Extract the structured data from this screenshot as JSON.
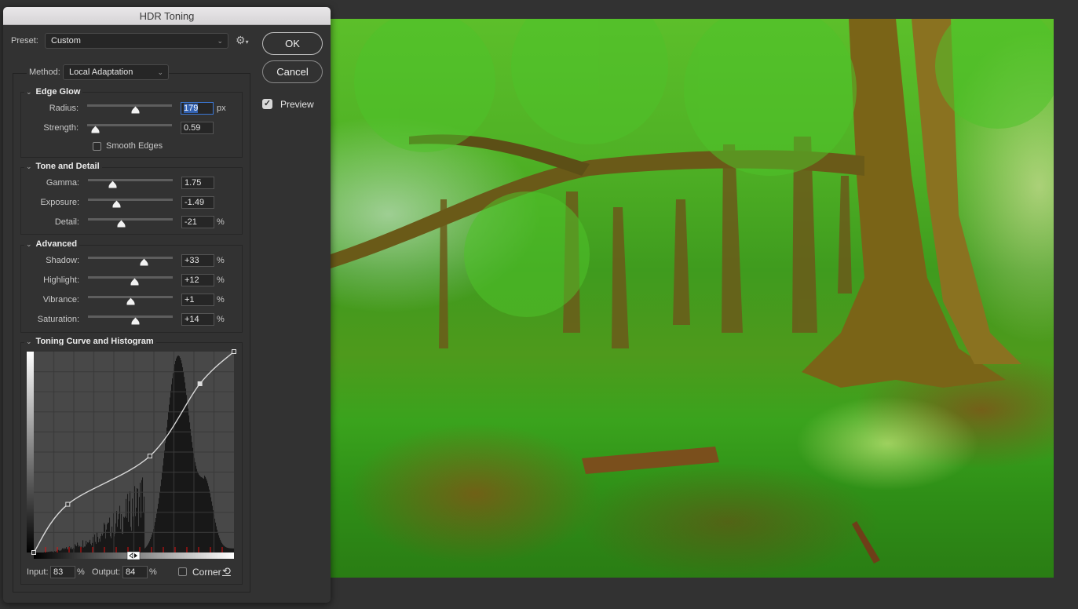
{
  "dialog": {
    "title": "HDR Toning",
    "preset": {
      "label": "Preset:",
      "value": "Custom",
      "gear_icon": "gear-icon"
    },
    "buttons": {
      "ok": "OK",
      "cancel": "Cancel"
    },
    "preview": {
      "label": "Preview",
      "checked": true
    },
    "method": {
      "label": "Method:",
      "value": "Local Adaptation"
    },
    "sections": {
      "edge_glow": {
        "title": "Edge Glow",
        "radius": {
          "label": "Radius:",
          "value": "179",
          "unit": "px",
          "slider_fraction": 0.57
        },
        "strength": {
          "label": "Strength:",
          "value": "0.59",
          "slider_fraction": 0.1
        },
        "smooth_edges": {
          "label": "Smooth Edges",
          "checked": false
        }
      },
      "tone_detail": {
        "title": "Tone and Detail",
        "gamma": {
          "label": "Gamma:",
          "value": "1.75",
          "slider_fraction": 0.29
        },
        "exposure": {
          "label": "Exposure:",
          "value": "-1.49",
          "slider_fraction": 0.34
        },
        "detail": {
          "label": "Detail:",
          "value": "-21",
          "unit": "%",
          "slider_fraction": 0.39
        }
      },
      "advanced": {
        "title": "Advanced",
        "shadow": {
          "label": "Shadow:",
          "value": "+33",
          "unit": "%",
          "slider_fraction": 0.66
        },
        "highlight": {
          "label": "Highlight:",
          "value": "+12",
          "unit": "%",
          "slider_fraction": 0.55
        },
        "vibrance": {
          "label": "Vibrance:",
          "value": "+1",
          "unit": "%",
          "slider_fraction": 0.5
        },
        "saturation": {
          "label": "Saturation:",
          "value": "+14",
          "unit": "%",
          "slider_fraction": 0.56
        }
      },
      "curve": {
        "title": "Toning Curve and Histogram",
        "points": [
          [
            0,
            0
          ],
          [
            17,
            24
          ],
          [
            58,
            48
          ],
          [
            83,
            84
          ],
          [
            100,
            100
          ]
        ],
        "selected_point_index": 3,
        "input": {
          "label": "Input:",
          "value": "83",
          "unit": "%"
        },
        "output": {
          "label": "Output:",
          "value": "84",
          "unit": "%"
        },
        "corner": {
          "label": "Corner",
          "checked": false
        },
        "reset_icon": "reset-icon"
      }
    }
  },
  "canvas": {
    "image_description": "HDR-toned forest with beech trees and red leaf litter"
  }
}
